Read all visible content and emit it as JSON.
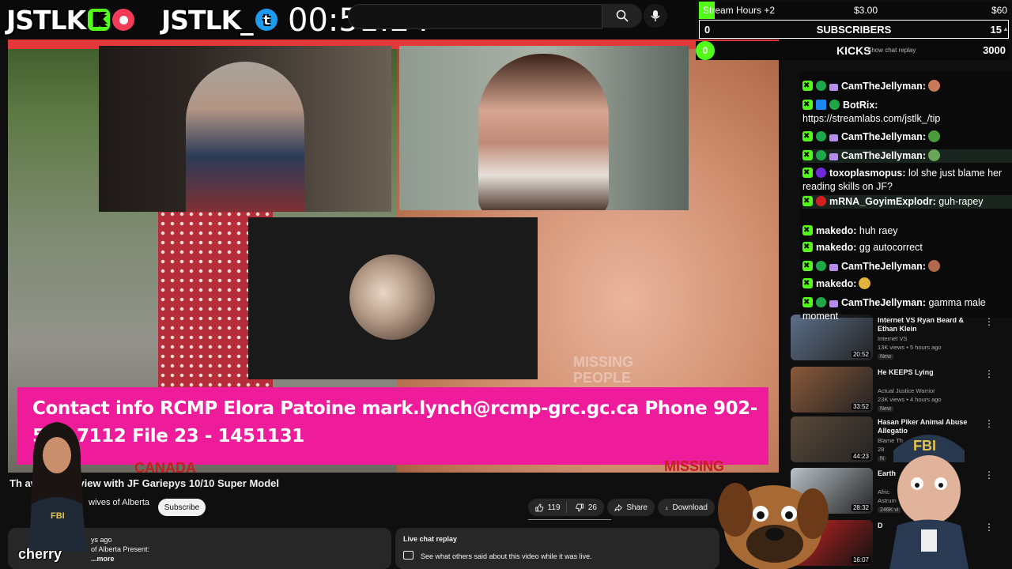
{
  "overlay": {
    "kick_logo_text": "JSTLK",
    "kick_badge": "K",
    "twitter_logo_text": "JSTLK_",
    "twitter_badge": "t",
    "timer": "00:51:24"
  },
  "goals": {
    "stream_hours": {
      "label": "Stream Hours +2",
      "current": "$3.00",
      "target": "$60",
      "progress": 0.05
    },
    "subscribers": {
      "label": "SUBSCRIBERS",
      "current": "0",
      "target": "15"
    },
    "kicks": {
      "label": "KICKS",
      "current": "0",
      "target": "3000"
    }
  },
  "ghost_text": "Show chat replay",
  "video": {
    "contact_banner": "Contact info RCMP Elora Patoine mark.lynch@rcmp-grc.gc.ca Phone 902-566-7112 File 23 - 1451131",
    "watermark": "MISSING PEOPLE",
    "canada": "CANADA",
    "missing": "MISSING"
  },
  "below_video": {
    "title": "Th away! Interview with JF Gariepys 10/10 Super Model",
    "channel": "wives of Alberta",
    "subscribe": "Subscribe",
    "likes": "119",
    "dislikes": "26",
    "share": "Share",
    "download": "Download"
  },
  "description": {
    "line1": "ys ago",
    "line2": "of Alberta Present:",
    "more": "...more"
  },
  "live_chat_replay": {
    "title": "Live chat replay",
    "subtitle": "See what others said about this video while it was live."
  },
  "cherry_name": "cherry",
  "chat": [
    {
      "user": "CamTheJellyman:",
      "text": "",
      "icons": [
        "x",
        "g",
        "gift"
      ],
      "emote": "#c97a5a",
      "top": 0
    },
    {
      "user": "BotRix:",
      "text": "https://streamlabs.com/jstlk_/tip",
      "icons": [
        "x",
        "b",
        "v"
      ]
    },
    {
      "user": "CamTheJellyman:",
      "text": "",
      "icons": [
        "x",
        "g",
        "gift"
      ],
      "emote": "#4b9b3a"
    },
    {
      "user": "CamTheJellyman:",
      "text": "",
      "icons": [
        "x",
        "g",
        "gift"
      ],
      "emote": "#6aa65a",
      "highlight": true
    },
    {
      "user": "toxoplasmopus:",
      "text": "lol she just blame her reading skills on JF?",
      "icons": [
        "x",
        "p"
      ]
    },
    {
      "user": "mRNA_GoyimExplodr:",
      "text": "guh-rapey",
      "icons": [
        "x",
        "r"
      ],
      "highlight": true
    },
    {
      "user": "makedo:",
      "text": "huh raey",
      "icons": [
        "x"
      ]
    },
    {
      "user": "makedo:",
      "text": "gg autocorrect",
      "icons": [
        "x"
      ]
    },
    {
      "user": "CamTheJellyman:",
      "text": "",
      "icons": [
        "x",
        "g",
        "gift"
      ],
      "emote": "#b06a4a"
    },
    {
      "user": "makedo:",
      "text": "",
      "icons": [
        "x"
      ],
      "emote": "#e3b23c"
    },
    {
      "user": "CamTheJellyman:",
      "text": "gamma male moment",
      "icons": [
        "x",
        "g",
        "gift"
      ]
    }
  ],
  "recommended": [
    {
      "title": "Internet VS Ryan Beard & Ethan Klein",
      "channel": "Internet VS",
      "meta": "13K views • 5 hours ago",
      "badge": "New",
      "duration": "20:52",
      "thumb": "#5d6f8a"
    },
    {
      "title": "He KEEPS Lying",
      "channel": "Actual Justice Warrior",
      "meta": "23K views • 4 hours ago",
      "badge": "New",
      "duration": "33:52",
      "thumb": "#8a5a3a"
    },
    {
      "title": "Hasan Piker Animal Abuse Allegatio",
      "channel": "Blame Th",
      "meta": "28",
      "badge": "N",
      "duration": "44:23",
      "thumb": "#5a4a3a"
    },
    {
      "title": "Earth",
      "channel": "Afric",
      "meta": "Astrum",
      "badge": "246K vi",
      "duration": "28:32",
      "thumb": "#b8c2c8"
    }
  ],
  "rec_extra": {
    "partial_title": "D",
    "duration": "16:07"
  }
}
